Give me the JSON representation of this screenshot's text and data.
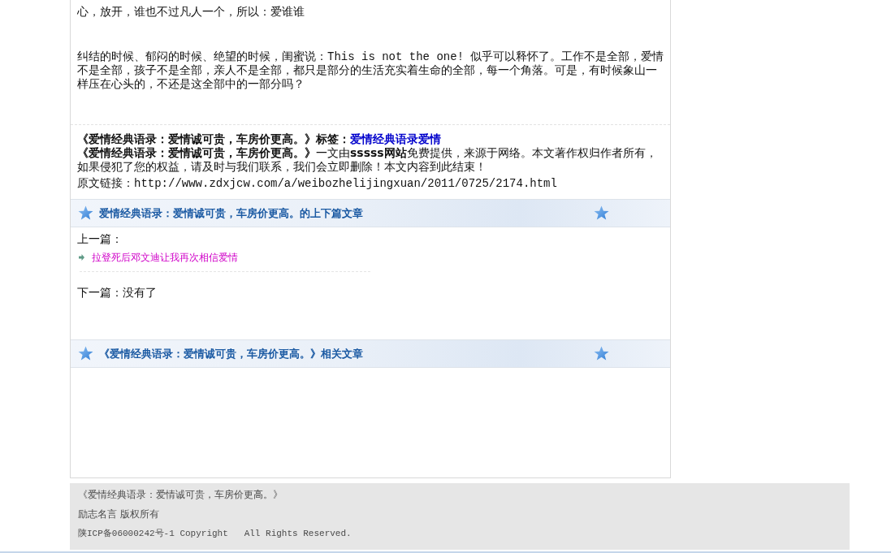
{
  "article": {
    "paragraphs": [
      "心，放开，谁也不过凡人一个，所以：爱谁谁",
      "纠结的时候、郁闷的时候、绝望的时候，闺蜜说：This is not the one! 似乎可以释怀了。工作不是全部，爱情不是全部，孩子不是全部，亲人不是全部，都只是部分的生活充实着生命的全部，每一个角落。可是，有时候象山一样压在心头的，不还是这全部中的一部分吗？"
    ]
  },
  "source": {
    "title_label": "《爱情经典语录：爱情诚可贵，车房价更高。》标签：",
    "tags": [
      {
        "label": "爱情经典语录爱情"
      }
    ],
    "notice": "**《爱情经典语录：爱情诚可贵，车房价更高。》**一文由**sssss网站**免费提供，来源于网络。本文著作权归作者所有，如果侵犯了您的权益，请及时与我们联系，我们会立即删除！本文内容到此结束！",
    "original_link": "原文链接：http://www.zdxjcw.com/a/weibozhelijingxuan/2011/0725/2174.html"
  },
  "prev_next": {
    "title": "爱情经典语录：爱情诚可贵，车房价更高。的上下篇文章",
    "prev_label": "上一篇：",
    "prev_links": [
      {
        "title": "拉登死后邓文迪让我再次相信爱情"
      }
    ],
    "next_label": "下一篇：没有了"
  },
  "related": {
    "title": "《爱情经典语录：爱情诚可贵，车房价更高。》相关文章"
  },
  "footer": {
    "lines": [
      {
        "kind": "title",
        "text": "《爱情经典语录：爱情诚可贵，车房价更高。》"
      },
      {
        "kind": "site",
        "text": "励志名言 版权所有"
      },
      {
        "kind": "copyright",
        "text": "陕ICP备06000242号-1 Copyright   All Rights Reserved."
      }
    ]
  }
}
